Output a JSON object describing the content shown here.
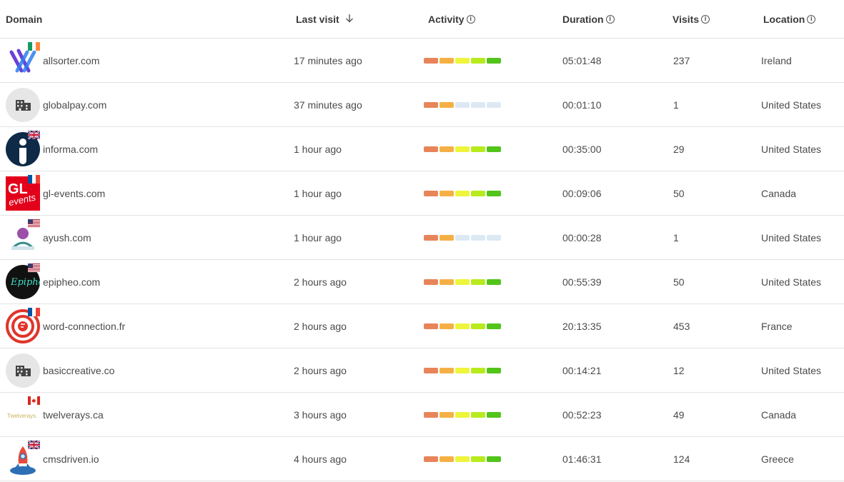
{
  "header": {
    "domain": "Domain",
    "last_visit": "Last visit",
    "activity": "Activity",
    "duration": "Duration",
    "visits": "Visits",
    "location": "Location"
  },
  "activity_colors": [
    "#e8845a",
    "#f5b045",
    "#eef53a",
    "#b7eb1e",
    "#52c41a"
  ],
  "activity_empty_color": "#dde8f5",
  "rows": [
    {
      "domain": "allsorter.com",
      "last_visit": "17 minutes ago",
      "activity": 5,
      "duration": "05:01:48",
      "visits": "237",
      "location": "Ireland",
      "logo": "allsorter-logo",
      "flag": "ireland-flag"
    },
    {
      "domain": "globalpay.com",
      "last_visit": "37 minutes ago",
      "activity": 2,
      "duration": "00:01:10",
      "visits": "1",
      "location": "United States",
      "logo": "building-icon",
      "flag": ""
    },
    {
      "domain": "informa.com",
      "last_visit": "1 hour ago",
      "activity": 5,
      "duration": "00:35:00",
      "visits": "29",
      "location": "United States",
      "logo": "informa-logo",
      "flag": "uk-flag"
    },
    {
      "domain": "gl-events.com",
      "last_visit": "1 hour ago",
      "activity": 5,
      "duration": "00:09:06",
      "visits": "50",
      "location": "Canada",
      "logo": "gl-events-logo",
      "flag": "france-flag"
    },
    {
      "domain": "ayush.com",
      "last_visit": "1 hour ago",
      "activity": 2,
      "duration": "00:00:28",
      "visits": "1",
      "location": "United States",
      "logo": "ayush-logo",
      "flag": "us-flag"
    },
    {
      "domain": "epipheo.com",
      "last_visit": "2 hours ago",
      "activity": 5,
      "duration": "00:55:39",
      "visits": "50",
      "location": "United States",
      "logo": "epipheo-logo",
      "flag": "us-flag"
    },
    {
      "domain": "word-connection.fr",
      "last_visit": "2 hours ago",
      "activity": 5,
      "duration": "20:13:35",
      "visits": "453",
      "location": "France",
      "logo": "word-connection-logo",
      "flag": "france-flag"
    },
    {
      "domain": "basiccreative.co",
      "last_visit": "2 hours ago",
      "activity": 5,
      "duration": "00:14:21",
      "visits": "12",
      "location": "United States",
      "logo": "building-icon",
      "flag": ""
    },
    {
      "domain": "twelverays.ca",
      "last_visit": "3 hours ago",
      "activity": 5,
      "duration": "00:52:23",
      "visits": "49",
      "location": "Canada",
      "logo": "twelverays-logo",
      "flag": "canada-flag"
    },
    {
      "domain": "cmsdriven.io",
      "last_visit": "4 hours ago",
      "activity": 5,
      "duration": "01:46:31",
      "visits": "124",
      "location": "Greece",
      "logo": "cmsdriven-logo",
      "flag": "uk-flag"
    }
  ]
}
